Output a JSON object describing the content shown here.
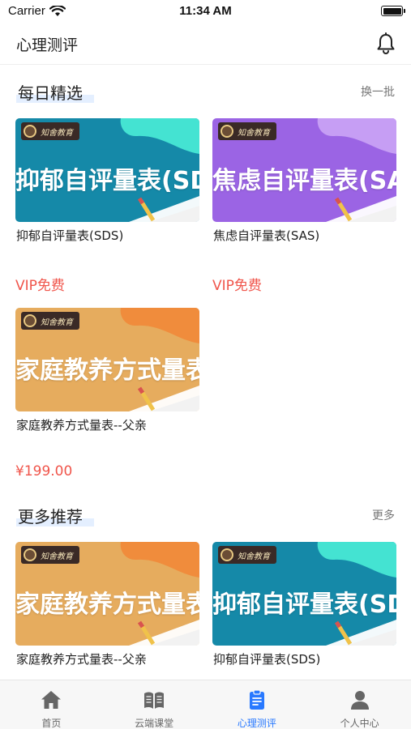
{
  "status_bar": {
    "carrier": "Carrier",
    "time": "11:34 AM"
  },
  "nav": {
    "title": "心理测评",
    "icon": "bell-icon"
  },
  "daily": {
    "title": "每日精选",
    "action": "换一批",
    "cards": [
      {
        "banner_text": "抑郁自评量表(SDS)",
        "title": "抑郁自评量表(SDS)",
        "price": "VIP免费",
        "bg": "#1589a8",
        "accent": "#44e3d2"
      },
      {
        "banner_text": "焦虑自评量表(SAS)",
        "title": "焦虑自评量表(SAS)",
        "price": "VIP免费",
        "bg": "#9b64e4",
        "accent": "#c69ef4"
      },
      {
        "banner_text": "家庭教养方式量表",
        "title": "家庭教养方式量表--父亲",
        "price": "¥199.00",
        "bg": "#e6ac5e",
        "accent": "#f08c3c"
      }
    ]
  },
  "more": {
    "title": "更多推荐",
    "action": "更多",
    "cards": [
      {
        "banner_text": "家庭教养方式量表",
        "title": "家庭教养方式量表--父亲",
        "bg": "#e6ac5e",
        "accent": "#f08c3c"
      },
      {
        "banner_text": "抑郁自评量表(SDS)",
        "title": "抑郁自评量表(SDS)",
        "bg": "#1589a8",
        "accent": "#44e3d2"
      }
    ]
  },
  "brand": {
    "name": "知舍教育"
  },
  "tabs": [
    {
      "label": "首页",
      "icon": "home-icon",
      "active": false
    },
    {
      "label": "云端课堂",
      "icon": "book-icon",
      "active": false
    },
    {
      "label": "心理测评",
      "icon": "clipboard-icon",
      "active": true
    },
    {
      "label": "个人中心",
      "icon": "person-icon",
      "active": false
    }
  ],
  "colors": {
    "accent": "#2979ff",
    "price": "#f0554b",
    "tab_inactive": "#777777"
  }
}
